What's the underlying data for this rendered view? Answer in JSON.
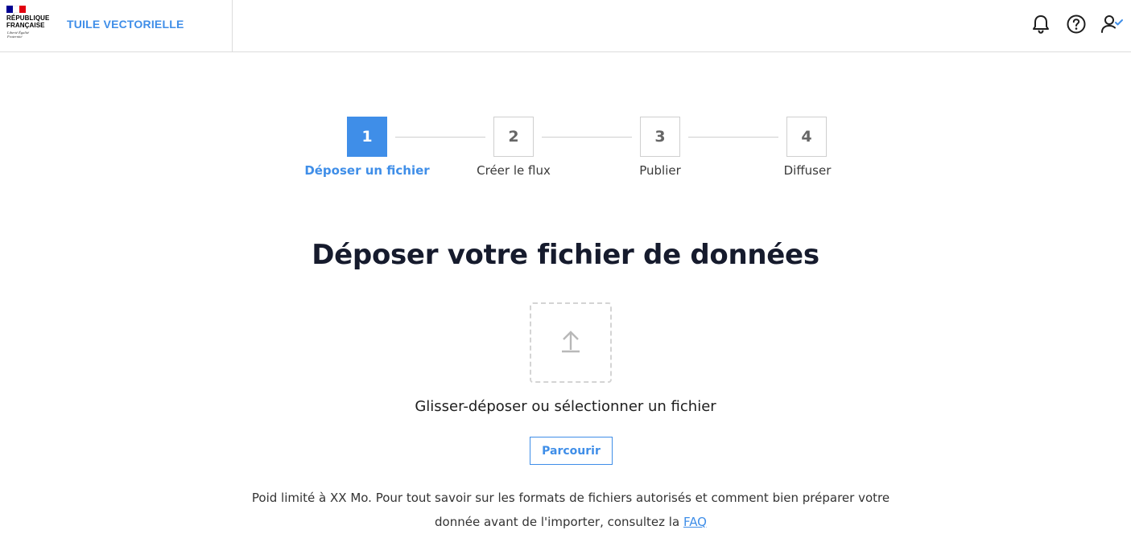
{
  "header": {
    "republic_name": "RÉPUBLIQUE FRANÇAISE",
    "republic_motto": "Liberté Égalité Fraternité",
    "app_title": "TUILE VECTORIELLE",
    "icons": [
      "bell-icon",
      "help-icon",
      "user-check-icon"
    ]
  },
  "stepper": {
    "steps": [
      {
        "number": "1",
        "label": "Déposer un fichier",
        "active": true
      },
      {
        "number": "2",
        "label": "Créer le flux",
        "active": false
      },
      {
        "number": "3",
        "label": "Publier",
        "active": false
      },
      {
        "number": "4",
        "label": "Diffuser",
        "active": false
      }
    ]
  },
  "main": {
    "title": "Déposer votre fichier de données",
    "dropzone_icon": "upload-icon",
    "dropzone_text": "Glisser-déposer ou sélectionner un fichier",
    "browse_label": "Parcourir",
    "info_text": "Poid limité à XX Mo. Pour tout savoir sur les formats de fichiers autorisés et comment bien préparer votre donnée avant de l'importer, consultez la",
    "faq_link": "FAQ"
  },
  "colors": {
    "accent": "#3f8ee8",
    "title": "#161b2d",
    "border": "#cfcfcf"
  }
}
